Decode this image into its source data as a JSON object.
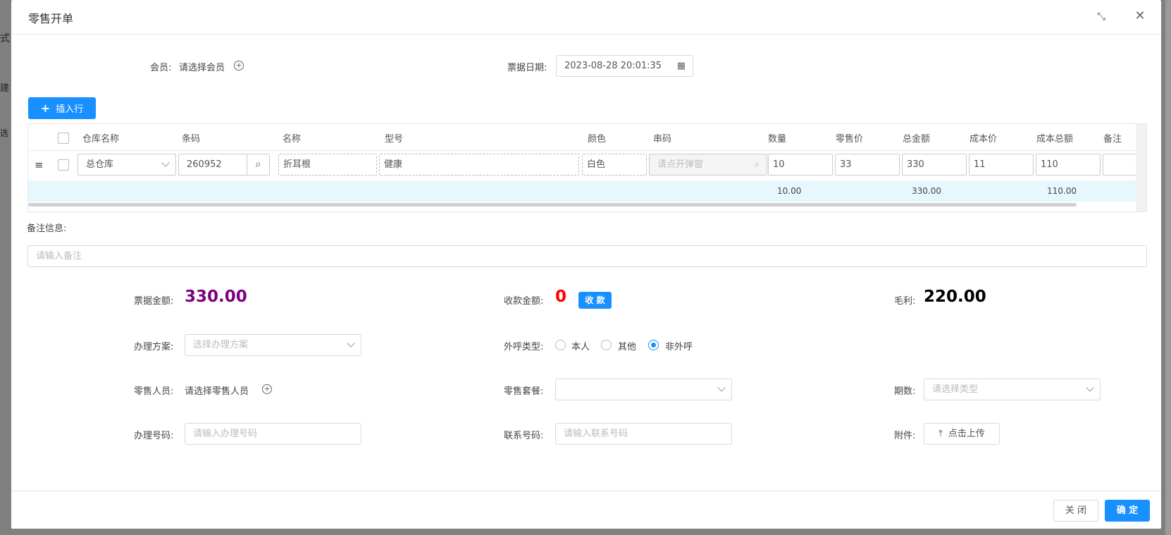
{
  "background": {
    "frag1": "式",
    "frag2": "建",
    "frag3": "选"
  },
  "dialog": {
    "title": "零售开单"
  },
  "member": {
    "label": "会员:",
    "value": "请选择会员"
  },
  "date": {
    "label": "票据日期:",
    "value": "2023-08-28 20:01:35"
  },
  "insert_row": {
    "label": "插入行"
  },
  "table": {
    "headers": [
      "仓库名称",
      "条码",
      "名称",
      "型号",
      "颜色",
      "串码",
      "数量",
      "零售价",
      "总金额",
      "成本价",
      "成本总额",
      "备注"
    ],
    "row": {
      "warehouse": "总仓库",
      "barcode": "260952",
      "name": "折耳根",
      "model": "健康",
      "color": "白色",
      "serial_placeholder": "请点开弹窗",
      "quantity": "10",
      "retail_price": "33",
      "total": "330",
      "cost_price": "11",
      "cost_total": "110"
    },
    "summary": {
      "quantity": "10.00",
      "total": "330.00",
      "cost_total": "110.00"
    }
  },
  "remark": {
    "label": "备注信息:",
    "placeholder": "请输入备注"
  },
  "amounts": {
    "bill_label": "票据金额:",
    "bill_value": "330.00",
    "received_label": "收款金额:",
    "received_value": "0",
    "collect_button": "收 款",
    "profit_label": "毛利:",
    "profit_value": "220.00"
  },
  "plan": {
    "label": "办理方案:",
    "placeholder": "选择办理方案"
  },
  "call_type": {
    "label": "外呼类型:",
    "options": [
      "本人",
      "其他",
      "非外呼"
    ],
    "selected": "非外呼"
  },
  "salesperson": {
    "label": "零售人员:",
    "value": "请选择零售人员"
  },
  "package": {
    "label": "零售套餐:",
    "value": ""
  },
  "period": {
    "label": "期数:",
    "placeholder": "请选择类型"
  },
  "handle_number": {
    "label": "办理号码:",
    "placeholder": "请输入办理号码"
  },
  "contact_number": {
    "label": "联系号码:",
    "placeholder": "请输入联系号码"
  },
  "attachment": {
    "label": "附件:",
    "button": "点击上传"
  },
  "footer": {
    "close": "关 闭",
    "confirm": "确 定"
  },
  "colors": {
    "primary": "#1890ff",
    "bill": "#800080",
    "received": "#ff0000",
    "profit": "#000000"
  }
}
